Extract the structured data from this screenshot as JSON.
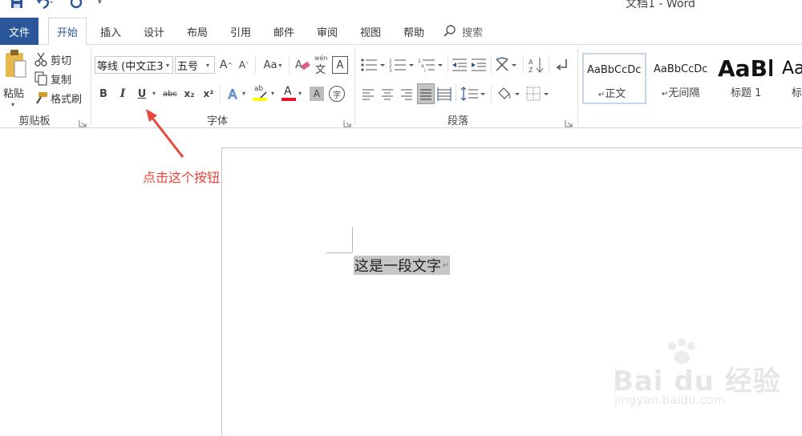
{
  "window": {
    "title": "文档1 - Word"
  },
  "quick_access": {
    "save_icon": "save-icon",
    "undo_icon": "undo-icon",
    "redo_icon": "redo-icon",
    "customize_icon": "customize-icon"
  },
  "tabs": {
    "file": "文件",
    "items": [
      "开始",
      "插入",
      "设计",
      "布局",
      "引用",
      "邮件",
      "审阅",
      "视图",
      "帮助"
    ],
    "active": "开始",
    "search_placeholder": "搜索"
  },
  "clipboard": {
    "paste": "粘贴",
    "cut": "剪切",
    "copy": "复制",
    "format_painter": "格式刷",
    "group_label": "剪贴板"
  },
  "font": {
    "font_name": "等线 (中文正3",
    "font_size": "五号",
    "grow": "A",
    "shrink": "A",
    "change_case": "Aa",
    "bold": "B",
    "italic": "I",
    "underline": "U",
    "strikethrough": "abc",
    "subscript": "x₂",
    "superscript": "x²",
    "phonetic": "文",
    "char_border": "A",
    "text_effect": "A",
    "highlight": "ab",
    "font_color": "A",
    "char_shading": "A",
    "enclosed": "字",
    "group_label": "字体",
    "highlight_color": "#ffff00",
    "font_color_value": "#e81123"
  },
  "paragraph": {
    "group_label": "段落"
  },
  "styles": {
    "items": [
      {
        "preview": "AaBbCcDc",
        "name": "正文"
      },
      {
        "preview": "AaBbCcDc",
        "name": "无间隔"
      },
      {
        "preview": "AaBl",
        "name": "标题 1"
      },
      {
        "preview": "Aa",
        "name": "标"
      }
    ]
  },
  "annotation": {
    "text": "点击这个按钮",
    "color": "#e8473b"
  },
  "document": {
    "text": "这是一段文字",
    "paragraph_mark": "↵"
  },
  "watermark": {
    "brand": "Bai du 经验",
    "url": "jingyan.baidu.com"
  },
  "accent": "#2b579a"
}
